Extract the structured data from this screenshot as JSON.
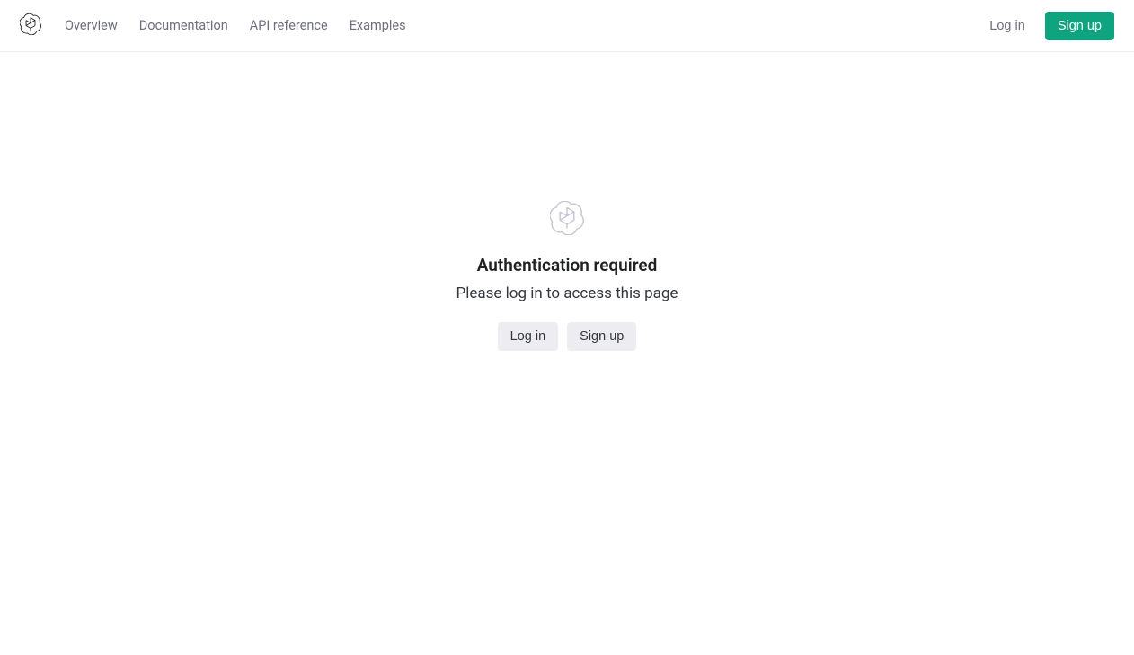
{
  "navbar": {
    "links": [
      "Overview",
      "Documentation",
      "API reference",
      "Examples"
    ],
    "login_label": "Log in",
    "signup_label": "Sign up"
  },
  "main": {
    "title": "Authentication required",
    "subtitle": "Please log in to access this page",
    "login_label": "Log in",
    "signup_label": "Sign up"
  }
}
